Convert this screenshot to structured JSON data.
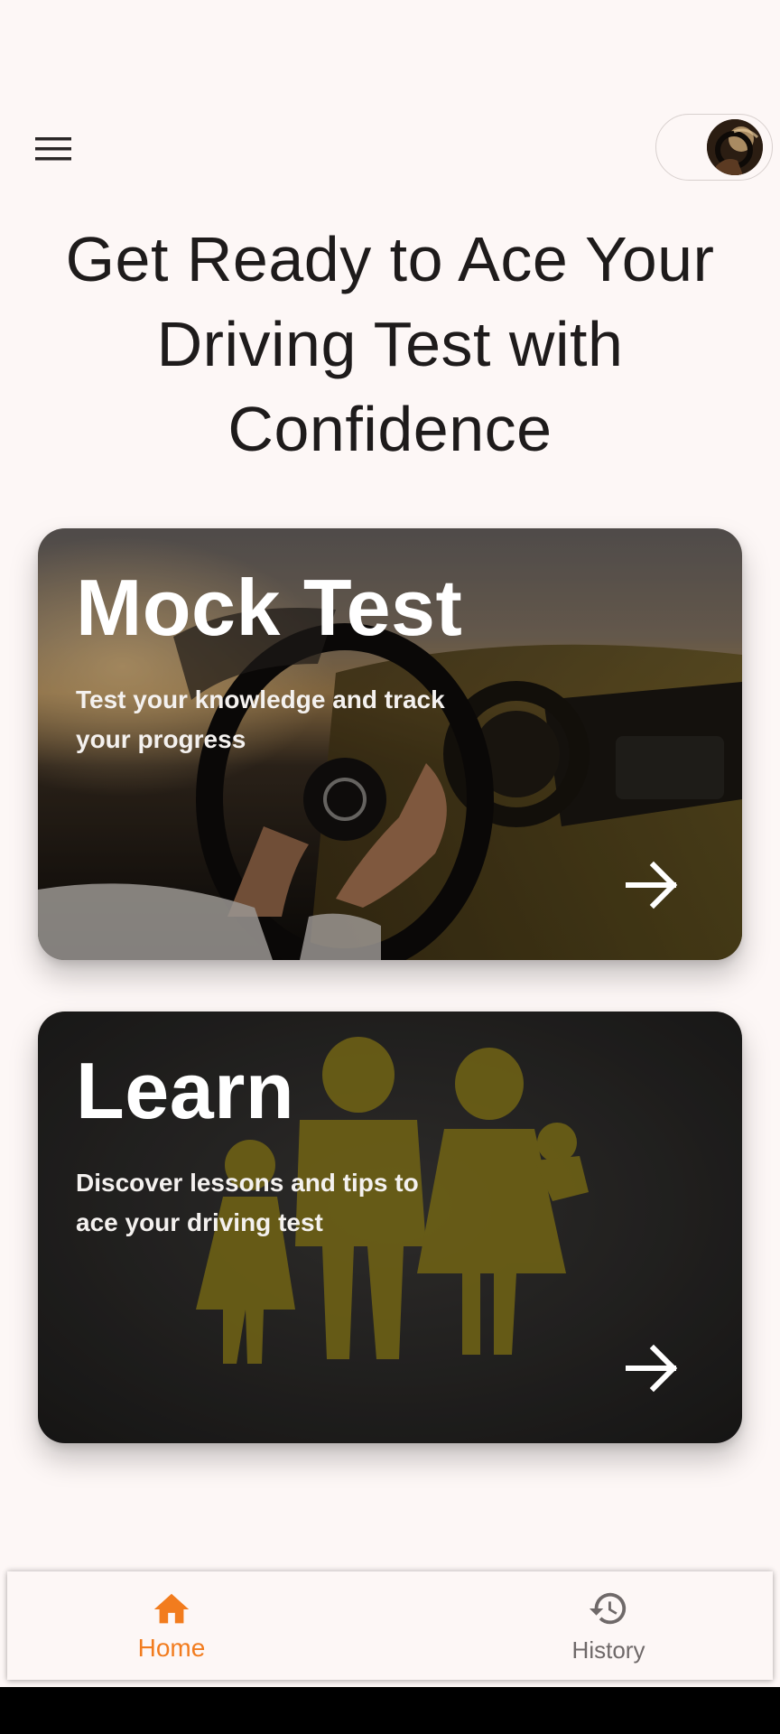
{
  "headline": "Get Ready to Ace Your Driving Test with Confidence",
  "cards": [
    {
      "title": "Mock Test",
      "description": "Test your knowledge and track your progress"
    },
    {
      "title": "Learn",
      "description": "Discover lessons and tips to ace your driving test"
    }
  ],
  "bottom_nav": {
    "items": [
      {
        "label": "Home",
        "icon": "home-icon",
        "active": true
      },
      {
        "label": "History",
        "icon": "history-icon",
        "active": false
      }
    ]
  },
  "colors": {
    "background": "#fdf7f6",
    "accent": "#f27c1e",
    "text": "#1e1b1b",
    "inactive": "#6f6969"
  }
}
